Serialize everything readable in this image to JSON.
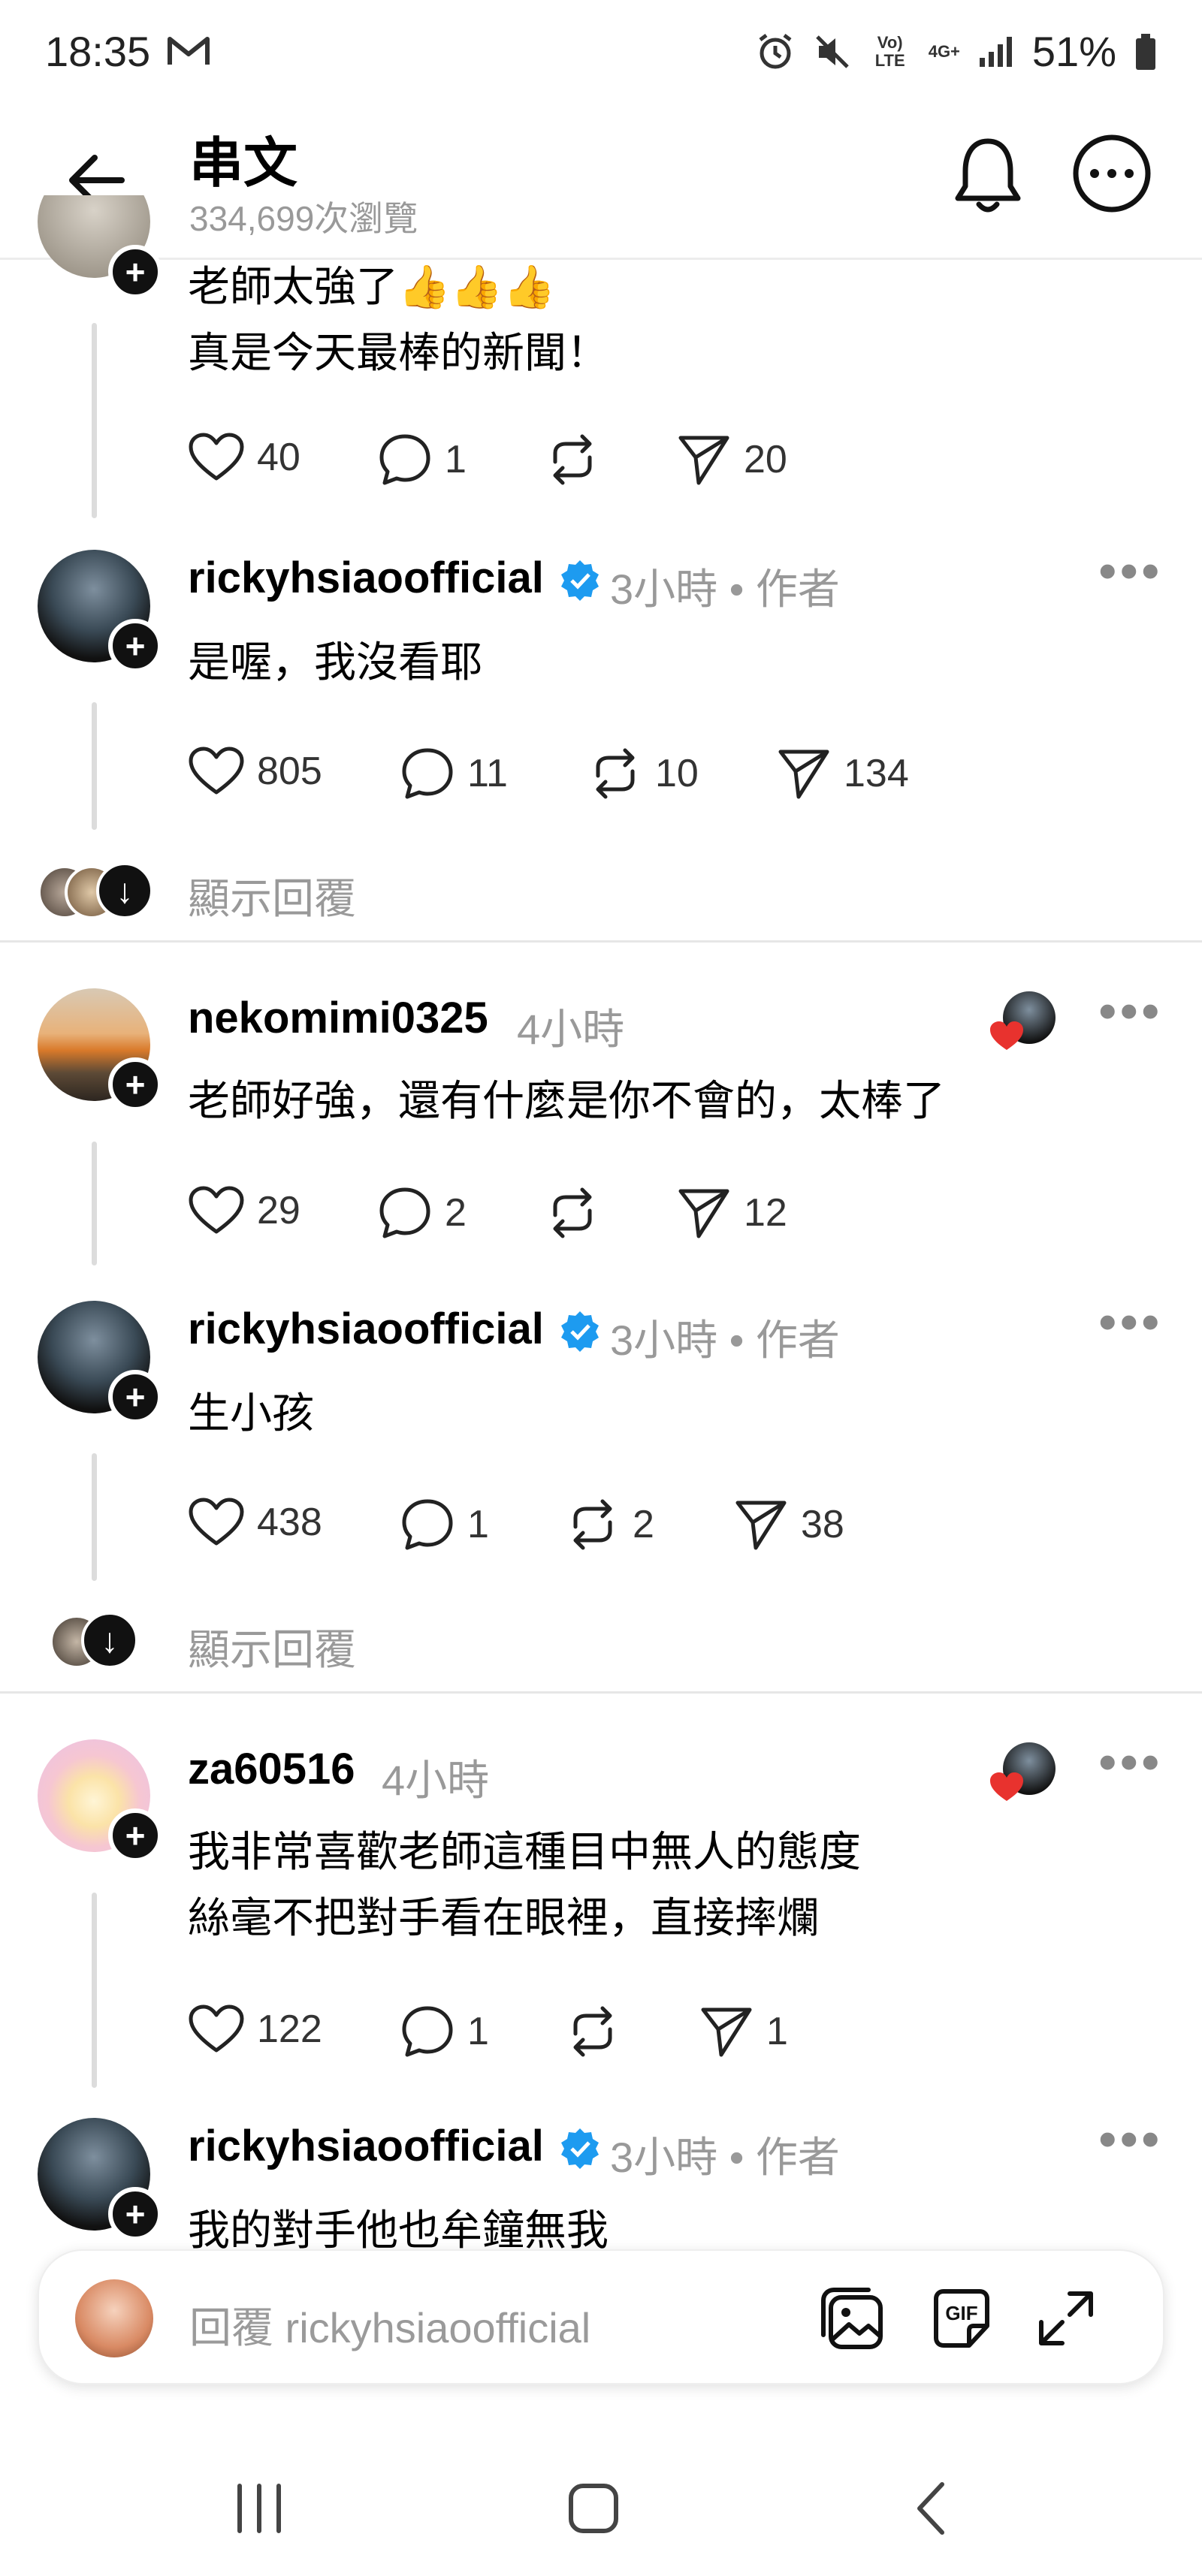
{
  "status_bar": {
    "time": "18:35",
    "battery": "51%",
    "network_1": "Vo) LTE",
    "network_2": "4G+"
  },
  "header": {
    "title": "串文",
    "views": "334,699次瀏覽"
  },
  "comments": [
    {
      "text_lines": [
        "老師太強了👍👍👍",
        "真是今天最棒的新聞！"
      ],
      "likes": "40",
      "replies": "1",
      "reposts": "",
      "shares": "20"
    },
    {
      "username": "rickyhsiaoofficial",
      "time": "3小時",
      "author_tag": "• 作者",
      "text_lines": [
        "是喔，我沒看耶"
      ],
      "likes": "805",
      "replies": "11",
      "reposts": "10",
      "shares": "134"
    },
    {
      "username": "nekomimi0325",
      "time": "4小時",
      "text_lines": [
        "老師好強，還有什麼是你不會的，太棒了"
      ],
      "likes": "29",
      "replies": "2",
      "reposts": "",
      "shares": "12"
    },
    {
      "username": "rickyhsiaoofficial",
      "time": "3小時",
      "author_tag": "• 作者",
      "text_lines": [
        "生小孩"
      ],
      "likes": "438",
      "replies": "1",
      "reposts": "2",
      "shares": "38"
    },
    {
      "username": "za60516",
      "time": "4小時",
      "text_lines": [
        "我非常喜歡老師這種目中無人的態度",
        "絲毫不把對手看在眼裡，直接摔爛"
      ],
      "likes": "122",
      "replies": "1",
      "reposts": "",
      "shares": "1"
    },
    {
      "username": "rickyhsiaoofficial",
      "time": "3小時",
      "author_tag": "• 作者",
      "text_lines": [
        "我的對手他也牟鐘無我"
      ]
    }
  ],
  "show_replies_label": "顯示回覆",
  "composer": {
    "placeholder": "回覆 rickyhsiaoofficial"
  },
  "colors": {
    "verified": "#1d9bf0",
    "heart_red": "#e8322e",
    "muted": "#999999"
  }
}
